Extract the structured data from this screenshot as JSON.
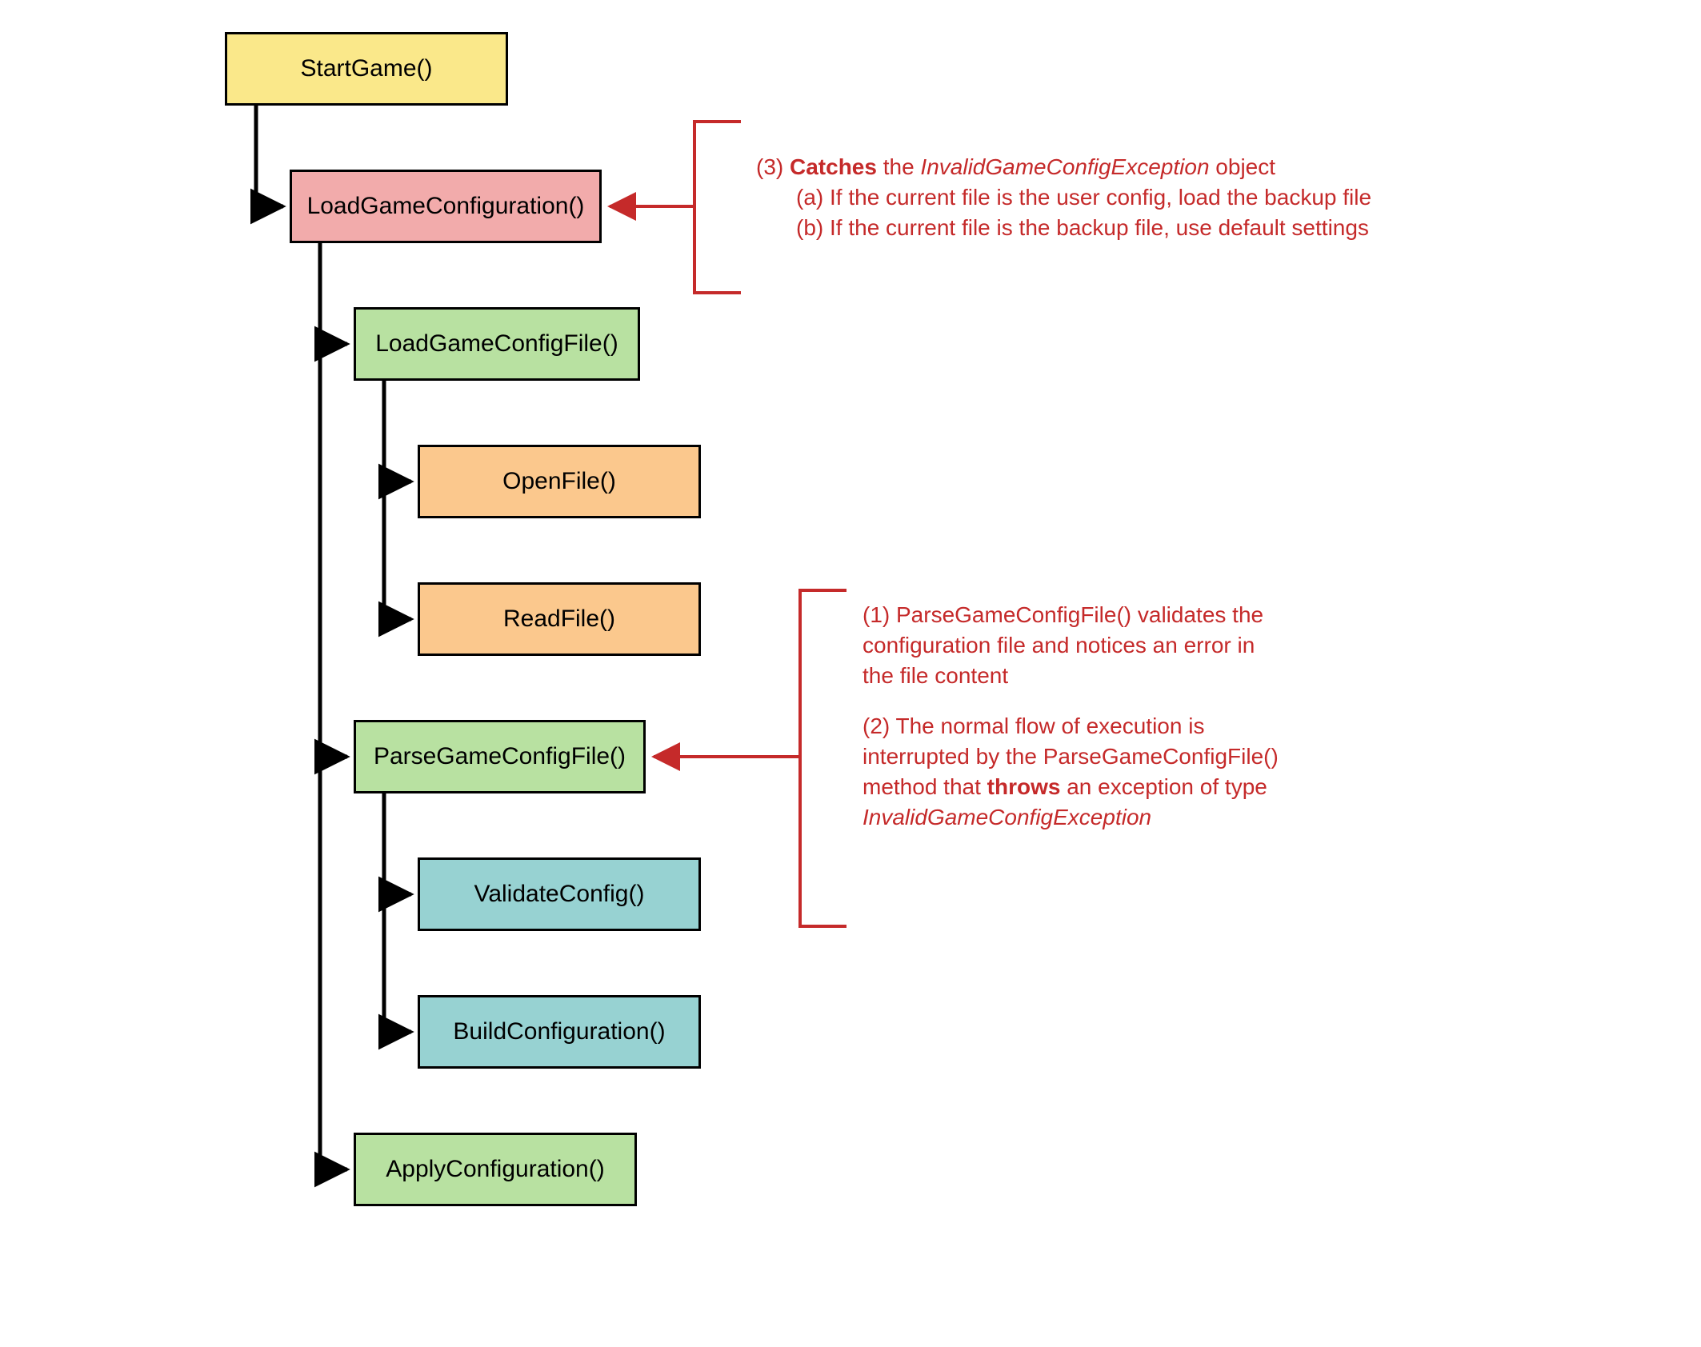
{
  "diagram": {
    "type": "call-flow",
    "nodes": {
      "start": {
        "label": "StartGame()",
        "color": "yellow"
      },
      "loadConfig": {
        "label": "LoadGameConfiguration()",
        "color": "pink"
      },
      "loadFile": {
        "label": "LoadGameConfigFile()",
        "color": "green"
      },
      "openFile": {
        "label": "OpenFile()",
        "color": "orange"
      },
      "readFile": {
        "label": "ReadFile()",
        "color": "orange"
      },
      "parseFile": {
        "label": "ParseGameConfigFile()",
        "color": "green"
      },
      "validate": {
        "label": "ValidateConfig()",
        "color": "teal"
      },
      "build": {
        "label": "BuildConfiguration()",
        "color": "teal"
      },
      "apply": {
        "label": "ApplyConfiguration()",
        "color": "green"
      }
    },
    "edges": [
      [
        "start",
        "loadConfig"
      ],
      [
        "loadConfig",
        "loadFile"
      ],
      [
        "loadConfig",
        "parseFile"
      ],
      [
        "loadConfig",
        "apply"
      ],
      [
        "loadFile",
        "openFile"
      ],
      [
        "loadFile",
        "readFile"
      ],
      [
        "parseFile",
        "validate"
      ],
      [
        "parseFile",
        "build"
      ]
    ],
    "annotations": {
      "catch": {
        "target": "loadConfig",
        "prefix": "(3) ",
        "bold": "Catches",
        "mid": " the ",
        "italic": "InvalidGameConfigException",
        "suffix": " object",
        "lineA": "(a) If the current file is the user config, load the backup file",
        "lineB": "(b) If the current file is the backup file, use default settings"
      },
      "throw": {
        "target": "parseFile",
        "p1": "(1) ParseGameConfigFile() validates the configuration file and notices an error in the file content",
        "p2a": "(2) The normal flow of execution is interrupted by the ParseGameConfigFile() method that ",
        "p2bold": "throws",
        "p2b": " an exception of type ",
        "p2italic": "InvalidGameConfigException"
      }
    },
    "colors": {
      "arrow": "#000000",
      "annotation": "#c52a2a"
    }
  }
}
